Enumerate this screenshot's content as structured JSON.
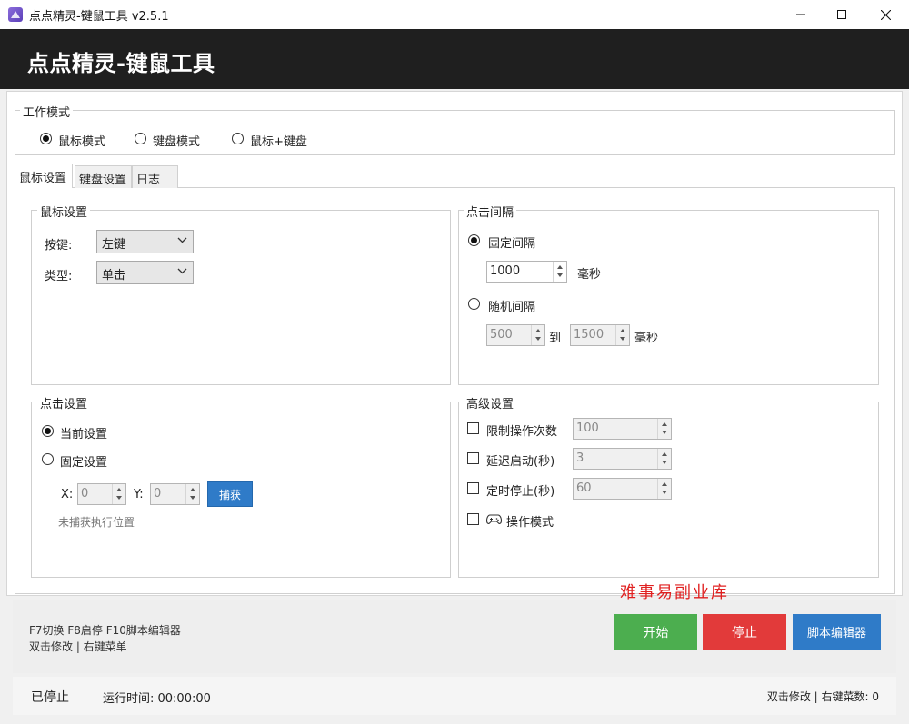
{
  "window": {
    "title": "点点精灵-键鼠工具 v2.5.1",
    "icon": "app-logo-icon",
    "controls": [
      "minimize-icon",
      "maximize-icon",
      "close-icon"
    ]
  },
  "header": {
    "title": "点点精灵-键鼠工具"
  },
  "work_mode": {
    "legend": "工作模式",
    "options": [
      {
        "label": "鼠标模式",
        "selected": true
      },
      {
        "label": "键盘模式",
        "selected": false
      },
      {
        "label": "鼠标+键盘",
        "selected": false
      }
    ]
  },
  "tabs": [
    {
      "label": "鼠标设置",
      "active": true
    },
    {
      "label": "键盘设置",
      "active": false
    },
    {
      "label": "日志",
      "active": false
    }
  ],
  "mouse_settings": {
    "legend": "鼠标设置",
    "button_label": "按键:",
    "button_value": "左键",
    "type_label": "类型:",
    "type_value": "单击"
  },
  "click_interval": {
    "legend": "点击间隔",
    "fixed_label": "固定间隔",
    "fixed_value": "1000",
    "fixed_unit": "毫秒",
    "random_label": "随机间隔",
    "random_min": "500",
    "random_to": "到",
    "random_max": "1500",
    "random_unit": "毫秒",
    "selected": "fixed"
  },
  "click_settings": {
    "legend": "点击设置",
    "current_label": "当前设置",
    "fixed_label": "固定设置",
    "selected": "current",
    "x_label": "X:",
    "x_value": "0",
    "y_label": "Y:",
    "y_value": "0",
    "capture_label": "捕获",
    "position_hint": "未捕获执行位置"
  },
  "advanced": {
    "legend": "高级设置",
    "limit_label": "限制操作次数",
    "limit_value": "100",
    "delay_label": "延迟启动(秒)",
    "delay_value": "3",
    "timer_label": "定时停止(秒)",
    "timer_value": "60",
    "gamepad_label": "操作模式",
    "gamepad_icon": "gamepad-icon"
  },
  "watermark": "难事易副业库",
  "bottom": {
    "hotkeys_hint": "F7切换 F8启停 F10脚本编辑器",
    "edit_hint": "双击修改 | 右键菜单",
    "start_label": "开始",
    "stop_label": "停止",
    "script_editor_label": "脚本编辑器"
  },
  "status": {
    "state": "已停止",
    "runtime": "运行时间: 00:00:00",
    "right_info": "双击修改 | 右键菜数: 0"
  },
  "colors": {
    "header_bg": "#1f1f1f",
    "start": "#4cae4f",
    "stop": "#e23a3a",
    "script_editor": "#2f7bc8",
    "capture": "#2f7bc8",
    "watermark": "#e02020"
  }
}
